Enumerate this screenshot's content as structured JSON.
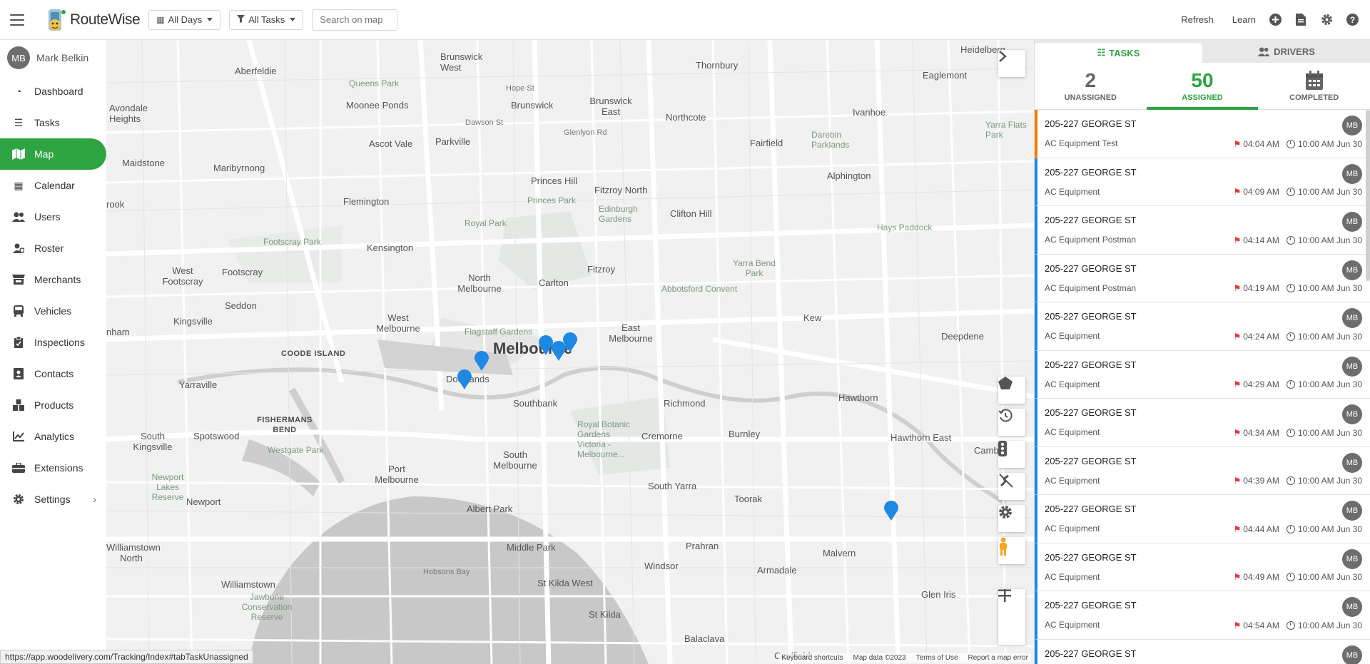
{
  "app": {
    "name": "RouteWise"
  },
  "toolbar": {
    "days_filter": "All Days",
    "tasks_filter": "All Tasks",
    "search_placeholder": "Search on map",
    "refresh": "Refresh",
    "learn": "Learn"
  },
  "user": {
    "initials": "MB",
    "name": "Mark Belkin"
  },
  "nav": [
    {
      "label": "Dashboard",
      "icon": "dashboard-icon"
    },
    {
      "label": "Tasks",
      "icon": "tasks-icon"
    },
    {
      "label": "Map",
      "icon": "map-icon",
      "active": true
    },
    {
      "label": "Calendar",
      "icon": "calendar-icon"
    },
    {
      "label": "Users",
      "icon": "users-icon"
    },
    {
      "label": "Roster",
      "icon": "roster-icon"
    },
    {
      "label": "Merchants",
      "icon": "merchants-icon"
    },
    {
      "label": "Vehicles",
      "icon": "vehicles-icon"
    },
    {
      "label": "Inspections",
      "icon": "inspections-icon"
    },
    {
      "label": "Contacts",
      "icon": "contacts-icon"
    },
    {
      "label": "Products",
      "icon": "products-icon"
    },
    {
      "label": "Analytics",
      "icon": "analytics-icon"
    },
    {
      "label": "Extensions",
      "icon": "extensions-icon"
    },
    {
      "label": "Settings",
      "icon": "settings-icon"
    }
  ],
  "map": {
    "labels": {
      "heidelberg": "Heidelberg",
      "brunswick_west": "Brunswick West",
      "thornbury": "Thornbury",
      "eaglemont": "Eaglemont",
      "aberfeldie": "Aberfeldie",
      "queens_park": "Queens Park",
      "hope_st": "Hope St",
      "brunswick": "Brunswick",
      "brunswick_east": "Brunswick East",
      "northcote": "Northcote",
      "ivanhoe": "Ivanhoe",
      "avondale_heights": "Avondale Heights",
      "moonee_ponds": "Moonee Ponds",
      "dawson_st": "Dawson St",
      "glenlyon_rd": "Glenlyon Rd",
      "darebin_parklands": "Darebin Parklands",
      "yarra_flats_park": "Yarra Flats Park",
      "ascot_vale": "Ascot Vale",
      "parkville": "Parkville",
      "fairfield": "Fairfield",
      "maidstone": "Maidstone",
      "maribyrnong": "Maribyrnong",
      "princes_hill": "Princes Hill",
      "fitzroy_north": "Fitzroy North",
      "alphington": "Alphington",
      "brook": "rook",
      "flemington": "Flemington",
      "princes_park": "Princes Park",
      "edinburgh_gardens": "Edinburgh Gardens",
      "clifton_hill": "Clifton Hill",
      "royal_park": "Royal Park",
      "hays_paddock": "Hays Paddock",
      "footscray_park": "Footscray Park",
      "kensington": "Kensington",
      "fitzroy": "Fitzroy",
      "yarra_bend_park": "Yarra Bend Park",
      "west_footscray": "West Footscray",
      "footscray": "Footscray",
      "north_melbourne": "North Melbourne",
      "carlton": "Carlton",
      "abbotsford_convent": "Abbotsford Convent",
      "seddon": "Seddon",
      "kew": "Kew",
      "kingsville": "Kingsville",
      "west_melbourne": "West Melbourne",
      "east_melbourne": "East Melbourne",
      "deepdene": "Deepdene",
      "nham": "nham",
      "flagstaff_gardens": "Flagstaff Gardens",
      "melbourne": "Melbourne",
      "coode_island": "COODE ISLAND",
      "docklands": "Docklands",
      "yarraville": "Yarraville",
      "richmond": "Richmond",
      "hawthorn": "Hawthorn",
      "southbank": "Southbank",
      "fishermans_bend": "FISHERMANS BEND",
      "royal_botanic_gardens": "Royal Botanic Gardens Victoria - Melbourne...",
      "cremorne": "Cremorne",
      "burnley": "Burnley",
      "hawthorn_east": "Hawthorn East",
      "camberwell": "Camberwell",
      "south_kingsville": "South Kingsville",
      "spotswood": "Spotswood",
      "westgate_park": "Westgate Park",
      "south_melbourne": "South Melbourne",
      "port_melbourne": "Port Melbourne",
      "newport_lakes": "Newport Lakes Reserve",
      "newport": "Newport",
      "south_yarra": "South Yarra",
      "toorak": "Toorak",
      "albert_park": "Albert Park",
      "williamstown_north": "Williamstown North",
      "middle_park": "Middle Park",
      "prahran": "Prahran",
      "malvern": "Malvern",
      "armadale": "Armadale",
      "windsor": "Windsor",
      "williamstown": "Williamstown",
      "hobsons_bay": "Hobsons Bay",
      "st_kilda_west": "St Kilda West",
      "jawbone": "Jawbone Conservation Reserve",
      "st_kilda": "St Kilda",
      "glen_iris": "Glen Iris",
      "balaclava": "Balaclava",
      "caulfield": "Caulfield"
    },
    "attribution": {
      "shortcuts": "Keyboard shortcuts",
      "data": "Map data ©2023",
      "terms": "Terms of Use",
      "report": "Report a map error"
    }
  },
  "panel": {
    "tabs": {
      "tasks": "TASKS",
      "drivers": "DRIVERS"
    },
    "counts": [
      {
        "num": "2",
        "label": "UNASSIGNED"
      },
      {
        "num": "50",
        "label": "ASSIGNED",
        "active": true
      },
      {
        "label": "COMPLETED"
      }
    ],
    "tasks": [
      {
        "address": "205-227 GEORGE ST",
        "name": "AC Equipment Test",
        "eta": "04:04 AM",
        "due": "10:00 AM Jun 30",
        "assignee": "MB"
      },
      {
        "address": "205-227 GEORGE ST",
        "name": "AC Equipment",
        "eta": "04:09 AM",
        "due": "10:00 AM Jun 30",
        "assignee": "MB"
      },
      {
        "address": "205-227 GEORGE ST",
        "name": "AC Equipment Postman",
        "eta": "04:14 AM",
        "due": "10:00 AM Jun 30",
        "assignee": "MB"
      },
      {
        "address": "205-227 GEORGE ST",
        "name": "AC Equipment Postman",
        "eta": "04:19 AM",
        "due": "10:00 AM Jun 30",
        "assignee": "MB"
      },
      {
        "address": "205-227 GEORGE ST",
        "name": "AC Equipment",
        "eta": "04:24 AM",
        "due": "10:00 AM Jun 30",
        "assignee": "MB"
      },
      {
        "address": "205-227 GEORGE ST",
        "name": "AC Equipment",
        "eta": "04:29 AM",
        "due": "10:00 AM Jun 30",
        "assignee": "MB"
      },
      {
        "address": "205-227 GEORGE ST",
        "name": "AC Equipment",
        "eta": "04:34 AM",
        "due": "10:00 AM Jun 30",
        "assignee": "MB"
      },
      {
        "address": "205-227 GEORGE ST",
        "name": "AC Equipment",
        "eta": "04:39 AM",
        "due": "10:00 AM Jun 30",
        "assignee": "MB"
      },
      {
        "address": "205-227 GEORGE ST",
        "name": "AC Equipment",
        "eta": "04:44 AM",
        "due": "10:00 AM Jun 30",
        "assignee": "MB"
      },
      {
        "address": "205-227 GEORGE ST",
        "name": "AC Equipment",
        "eta": "04:49 AM",
        "due": "10:00 AM Jun 30",
        "assignee": "MB"
      },
      {
        "address": "205-227 GEORGE ST",
        "name": "AC Equipment",
        "eta": "04:54 AM",
        "due": "10:00 AM Jun 30",
        "assignee": "MB"
      },
      {
        "address": "205-227 GEORGE ST",
        "assignee": "MB"
      }
    ]
  },
  "status_url": "https://app.woodelivery.com/Tracking/Index#tabTaskUnassigned",
  "colors": {
    "accent": "#2ea443",
    "pin": "#1e88e5",
    "task_bar_default": "#1e88e5",
    "task_bar_first": "#f57c00",
    "flag": "#e53935"
  }
}
